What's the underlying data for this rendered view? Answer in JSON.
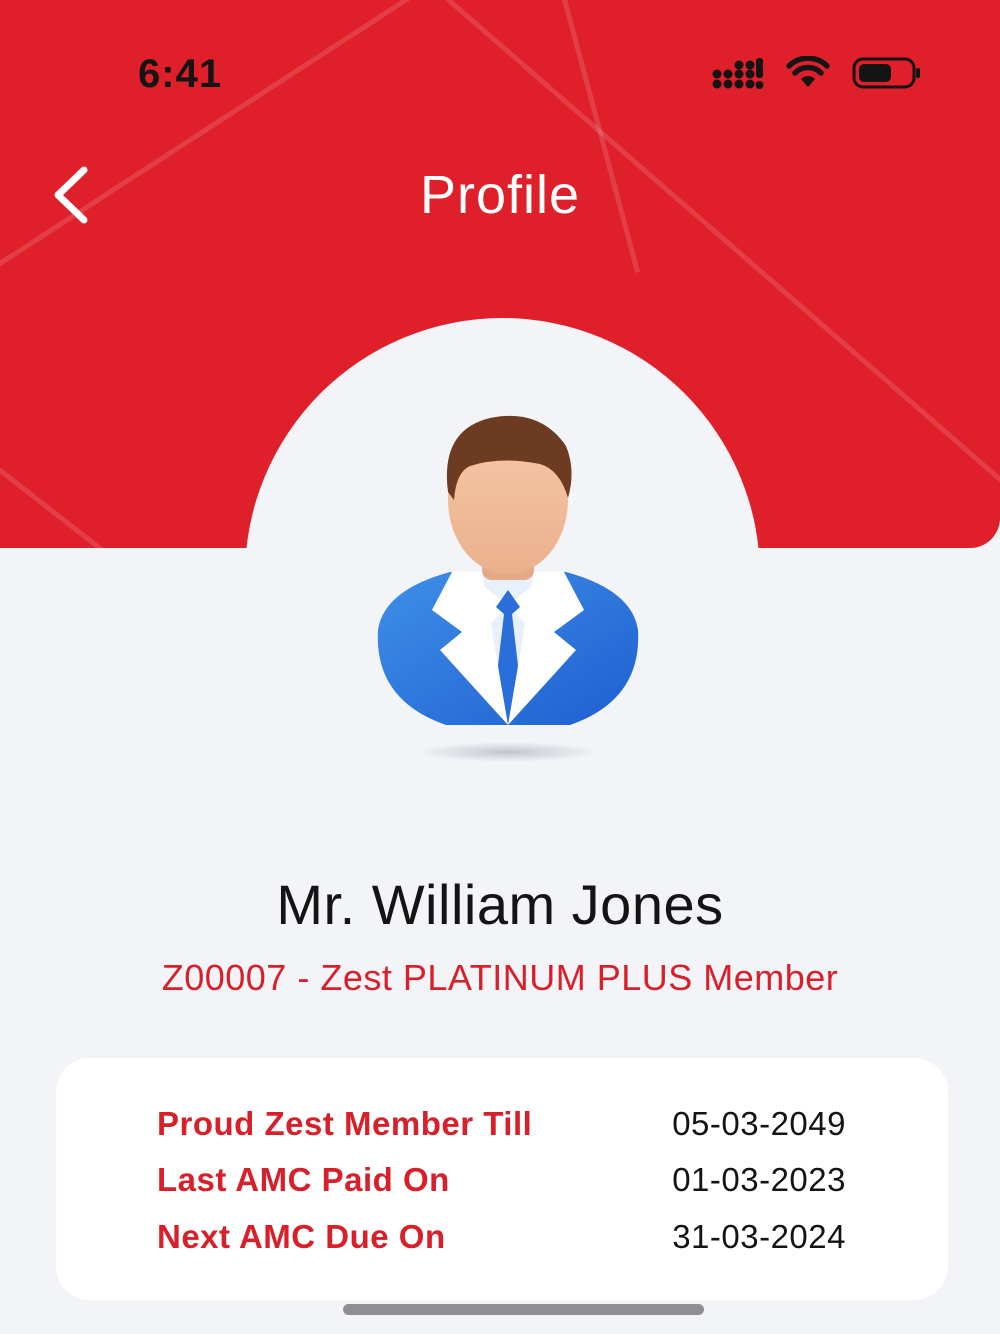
{
  "status_bar": {
    "time": "6:41",
    "icons": [
      "cellular-signal-icon",
      "wifi-icon",
      "battery-icon"
    ]
  },
  "header": {
    "title": "Profile",
    "back_icon": "chevron-left-icon",
    "accent_color": "#df1f2a"
  },
  "profile": {
    "avatar_icon": "businessman-avatar-icon",
    "name": "Mr. William Jones",
    "member_line": "Z00007 - Zest PLATINUM PLUS Member"
  },
  "membership_details": [
    {
      "label": "Proud Zest Member Till",
      "value": "05-03-2049"
    },
    {
      "label": "Last AMC Paid On",
      "value": "01-03-2023"
    },
    {
      "label": "Next AMC Due On",
      "value": "31-03-2024"
    }
  ]
}
